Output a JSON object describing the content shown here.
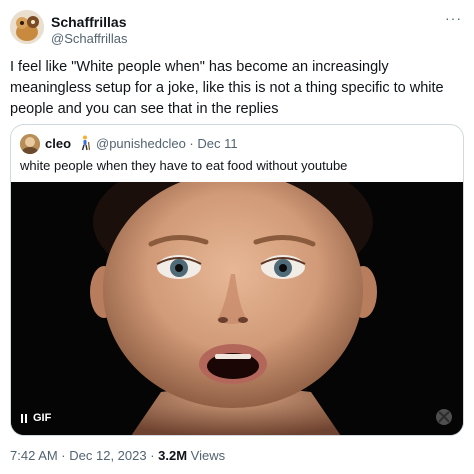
{
  "author": {
    "name": "Schaffrillas",
    "handle": "@Schaffrillas"
  },
  "tweet": {
    "text": "I feel like \"White people when\" has become an increasingly meaningless setup for a joke, like this is not a thing specific to white people and you can see that in the replies"
  },
  "quote": {
    "name": "cleo",
    "emoji_icon": "person-walking-with-cane-emoji",
    "meta": "@punishedcleo · Dec 11",
    "text": "white people when they have to eat food without youtube",
    "media": {
      "badge": "GIF",
      "pause_icon": "pause-icon",
      "watermark_icon": "xbox-icon"
    }
  },
  "footer": {
    "timestamp": "7:42 AM · Dec 12, 2023 · ",
    "views_count": "3.2M",
    "views_label": " Views"
  },
  "icons": {
    "more": "more-options-icon"
  },
  "colors": {
    "text": "#0f1419",
    "secondary": "#536471",
    "border": "#cfd9de"
  }
}
